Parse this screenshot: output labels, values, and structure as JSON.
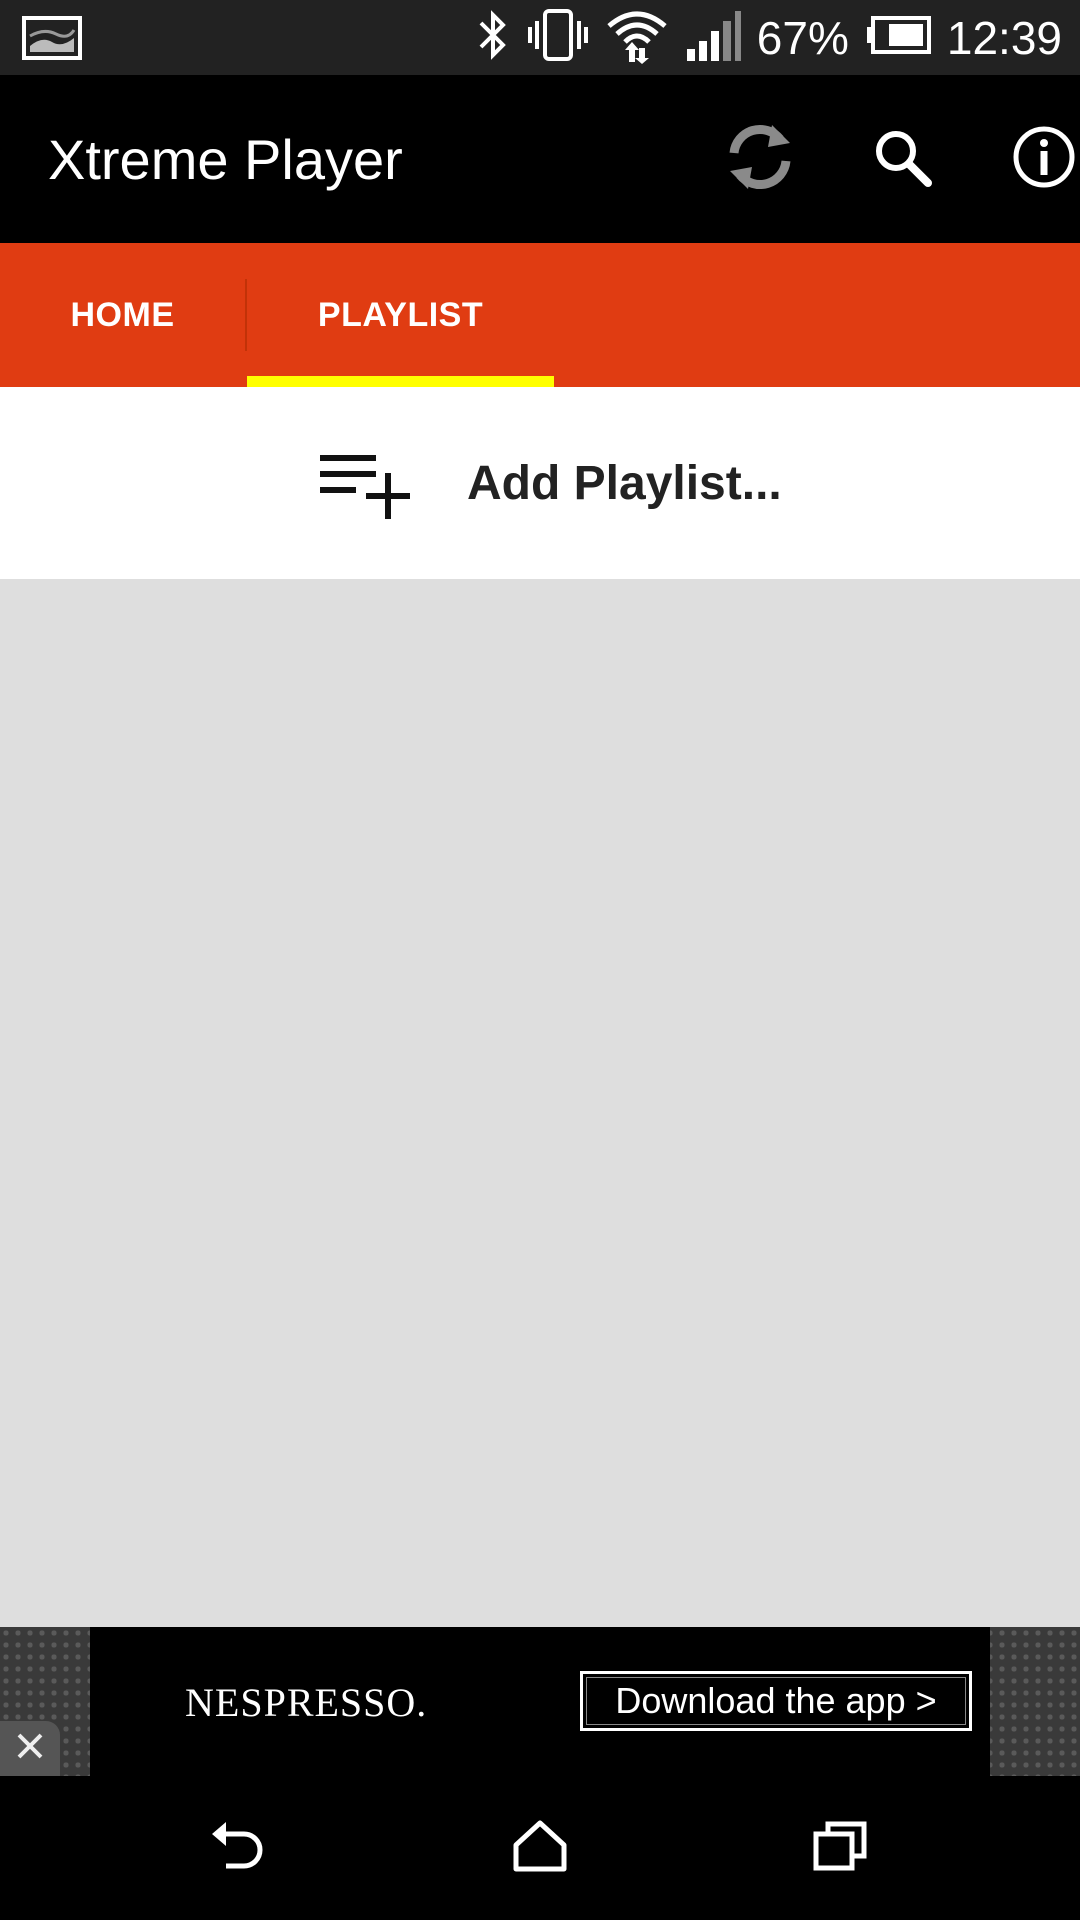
{
  "status_bar": {
    "battery_percent": "67%",
    "time": "12:39",
    "icons": [
      "gallery-icon",
      "bluetooth-icon",
      "vibrate-icon",
      "wifi-icon",
      "signal-icon",
      "battery-icon"
    ]
  },
  "app_bar": {
    "title": "Xtreme Player",
    "actions": [
      "refresh-icon",
      "search-icon",
      "info-icon"
    ]
  },
  "tabs": {
    "items": [
      {
        "label": "HOME",
        "selected": false
      },
      {
        "label": "PLAYLIST",
        "selected": true
      }
    ],
    "accent": "#e03c12",
    "indicator_color": "#ffff00"
  },
  "playlist": {
    "add_label": "Add Playlist..."
  },
  "ad": {
    "brand": "NESPRESSO.",
    "cta": "Download the app >"
  },
  "nav_bar": {
    "buttons": [
      "back-icon",
      "home-icon",
      "recents-icon"
    ]
  }
}
